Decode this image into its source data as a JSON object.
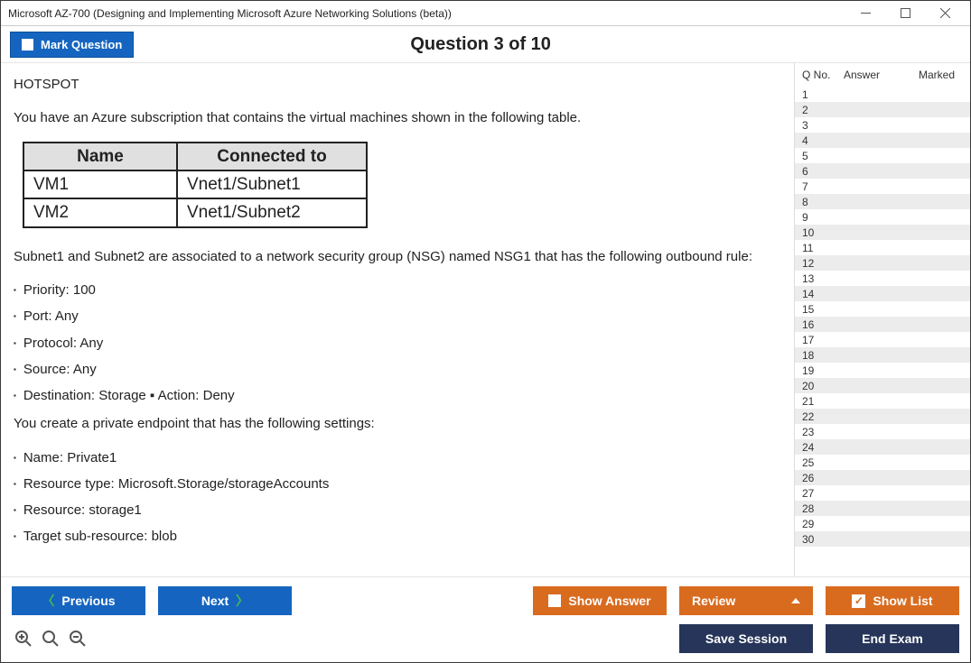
{
  "window": {
    "title": "Microsoft AZ-700 (Designing and Implementing Microsoft Azure Networking Solutions (beta))"
  },
  "header": {
    "mark_label": "Mark Question",
    "question_title": "Question 3 of 10"
  },
  "question": {
    "tag": "HOTSPOT",
    "intro": "You have an Azure subscription that contains the virtual machines shown in the following table.",
    "table": {
      "headers": {
        "name": "Name",
        "connected": "Connected to"
      },
      "rows": [
        {
          "name": "VM1",
          "connected": "Vnet1/Subnet1"
        },
        {
          "name": "VM2",
          "connected": "Vnet1/Subnet2"
        }
      ]
    },
    "nsg_line": "Subnet1 and Subnet2 are associated to a network security group (NSG) named NSG1 that has the following outbound rule:",
    "nsg_bullets": [
      "Priority: 100",
      "Port: Any",
      "Protocol: Any",
      "Source: Any",
      "Destination: Storage ▪ Action: Deny"
    ],
    "pe_line": "You create a private endpoint that has the following settings:",
    "pe_bullets": [
      "Name: Private1",
      "Resource type: Microsoft.Storage/storageAccounts",
      "Resource: storage1",
      "Target sub-resource: blob"
    ]
  },
  "side": {
    "headers": {
      "qno": "Q No.",
      "answer": "Answer",
      "marked": "Marked"
    },
    "count": 30
  },
  "footer": {
    "prev": "Previous",
    "next": "Next",
    "show_answer": "Show Answer",
    "review": "Review",
    "show_list": "Show List",
    "save_session": "Save Session",
    "end_exam": "End Exam"
  }
}
